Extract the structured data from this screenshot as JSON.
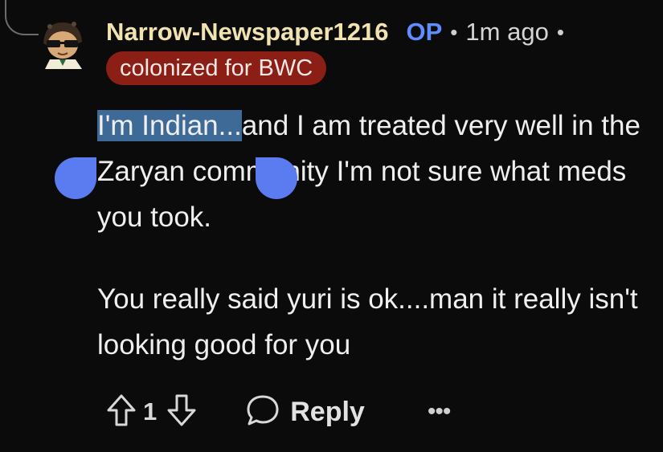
{
  "comment": {
    "username": "Narrow-Newspaper1216",
    "op_badge": "OP",
    "separator": "•",
    "time": "1m ago",
    "flair": "colonized for BWC",
    "colors": {
      "username": "#f1e2b2",
      "op": "#5f8dff",
      "flair_bg": "#8b1f16",
      "selection": "#3d6a96",
      "handle": "#5b7cf0"
    },
    "body": {
      "selected_text": "I'm Indian...",
      "para1_rest": "and I am treated very well in the Zaryan community I'm not sure what meds you took.",
      "para2": "You really said yuri is ok....man it really isn't looking good for you"
    }
  },
  "actions": {
    "upvote_icon": "arrow-up-outline-icon",
    "vote_count": "1",
    "downvote_icon": "arrow-down-outline-icon",
    "reply_icon": "speech-bubble-icon",
    "reply_label": "Reply",
    "more_label": "•••"
  }
}
